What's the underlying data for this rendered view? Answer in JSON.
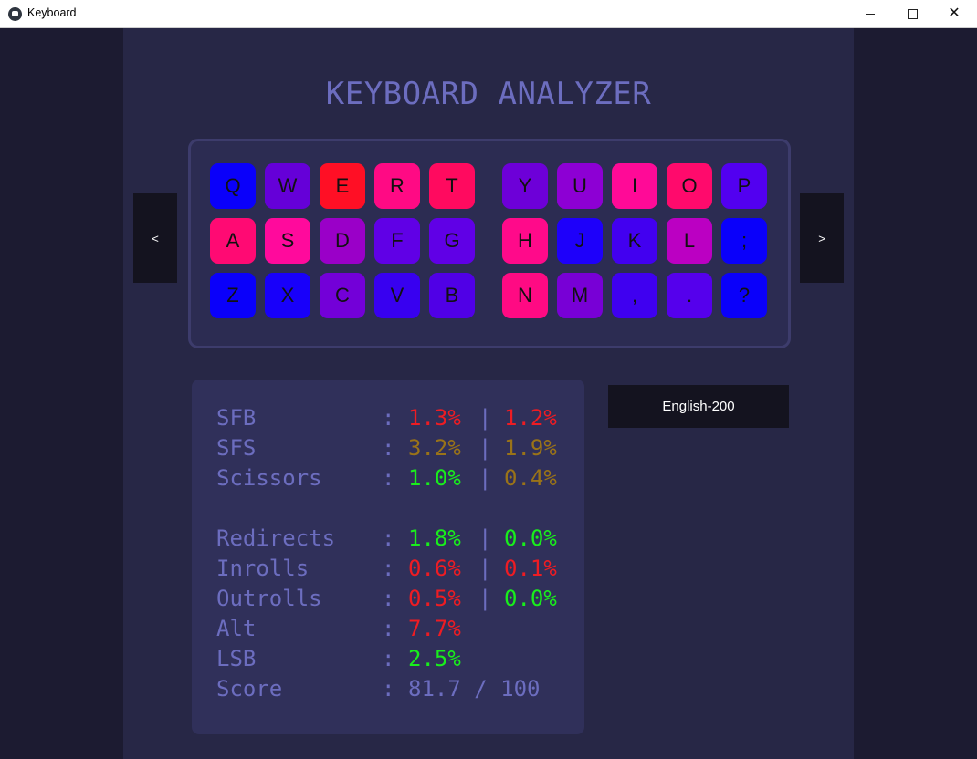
{
  "window": {
    "title": "Keyboard",
    "minimize": "",
    "maximize": "",
    "close": "✕"
  },
  "app": {
    "title": "KEYBOARD ANALYZER"
  },
  "nav": {
    "prev": "<",
    "next": ">"
  },
  "dataset": {
    "label": "English-200"
  },
  "colors": {
    "background": "#1c1b31",
    "panel": "#272746",
    "accent_text": "#6c6dbf",
    "bad": "#ee1c23",
    "warn": "#9a7318",
    "good": "#19ee1c"
  },
  "keyboard": {
    "rows": [
      [
        {
          "label": "Q",
          "color": "#0a00fa"
        },
        {
          "label": "W",
          "color": "#6500d8"
        },
        {
          "label": "E",
          "color": "#ff0f25"
        },
        {
          "label": "R",
          "color": "#ff0a84"
        },
        {
          "label": "T",
          "color": "#ff0a5f"
        },
        {
          "label": "Y",
          "color": "#6d00d8"
        },
        {
          "label": "U",
          "color": "#8d00d4"
        },
        {
          "label": "I",
          "color": "#ff0a97"
        },
        {
          "label": "O",
          "color": "#ff0a6c"
        },
        {
          "label": "P",
          "color": "#5200f0"
        }
      ],
      [
        {
          "label": "A",
          "color": "#ff0a73"
        },
        {
          "label": "S",
          "color": "#ff0a9c"
        },
        {
          "label": "D",
          "color": "#9a00c8"
        },
        {
          "label": "F",
          "color": "#6000e6"
        },
        {
          "label": "G",
          "color": "#6000e6"
        },
        {
          "label": "H",
          "color": "#ff0a8a"
        },
        {
          "label": "J",
          "color": "#1e00fa"
        },
        {
          "label": "K",
          "color": "#4200f0"
        },
        {
          "label": "L",
          "color": "#bb00c2"
        },
        {
          "label": ";",
          "color": "#0a00fa"
        }
      ],
      [
        {
          "label": "Z",
          "color": "#0a00fa"
        },
        {
          "label": "X",
          "color": "#1800fa"
        },
        {
          "label": "C",
          "color": "#7300d8"
        },
        {
          "label": "V",
          "color": "#3800f0"
        },
        {
          "label": "B",
          "color": "#5000e6"
        },
        {
          "label": "N",
          "color": "#ff0a83"
        },
        {
          "label": "M",
          "color": "#7800d6"
        },
        {
          "label": ",",
          "color": "#3f00f0"
        },
        {
          "label": ".",
          "color": "#5500ec"
        },
        {
          "label": "?",
          "color": "#0a00fa"
        }
      ]
    ]
  },
  "stats": [
    {
      "name": "SFB",
      "sep": ":",
      "v1": "1.3%",
      "v1_color": "#ee1c23",
      "bar": "|",
      "v2": "1.2%",
      "v2_color": "#ee1c23"
    },
    {
      "name": "SFS",
      "sep": ":",
      "v1": "3.2%",
      "v1_color": "#9a7318",
      "bar": "|",
      "v2": "1.9%",
      "v2_color": "#9a7318"
    },
    {
      "name": "Scissors",
      "sep": ":",
      "v1": "1.0%",
      "v1_color": "#19ee1c",
      "bar": "|",
      "v2": "0.4%",
      "v2_color": "#9a7318"
    },
    {
      "name": "Redirects",
      "sep": ":",
      "v1": "1.8%",
      "v1_color": "#19ee1c",
      "bar": "|",
      "v2": "0.0%",
      "v2_color": "#19ee1c"
    },
    {
      "name": "Inrolls",
      "sep": ":",
      "v1": "0.6%",
      "v1_color": "#ee1c23",
      "bar": "|",
      "v2": "0.1%",
      "v2_color": "#ee1c23"
    },
    {
      "name": "Outrolls",
      "sep": ":",
      "v1": "0.5%",
      "v1_color": "#ee1c23",
      "bar": "|",
      "v2": "0.0%",
      "v2_color": "#19ee1c"
    },
    {
      "name": "Alt",
      "sep": ":",
      "v1": "7.7%",
      "v1_color": "#ee1c23",
      "bar": "",
      "v2": "",
      "v2_color": "#6c6dbf"
    },
    {
      "name": "LSB",
      "sep": ":",
      "v1": "2.5%",
      "v1_color": "#19ee1c",
      "bar": "",
      "v2": "",
      "v2_color": "#6c6dbf"
    },
    {
      "name": "Score",
      "sep": ":",
      "v1": "81.7 / 100",
      "v1_color": "#6c6dbf",
      "bar": "",
      "v2": "",
      "v2_color": "#6c6dbf"
    }
  ]
}
